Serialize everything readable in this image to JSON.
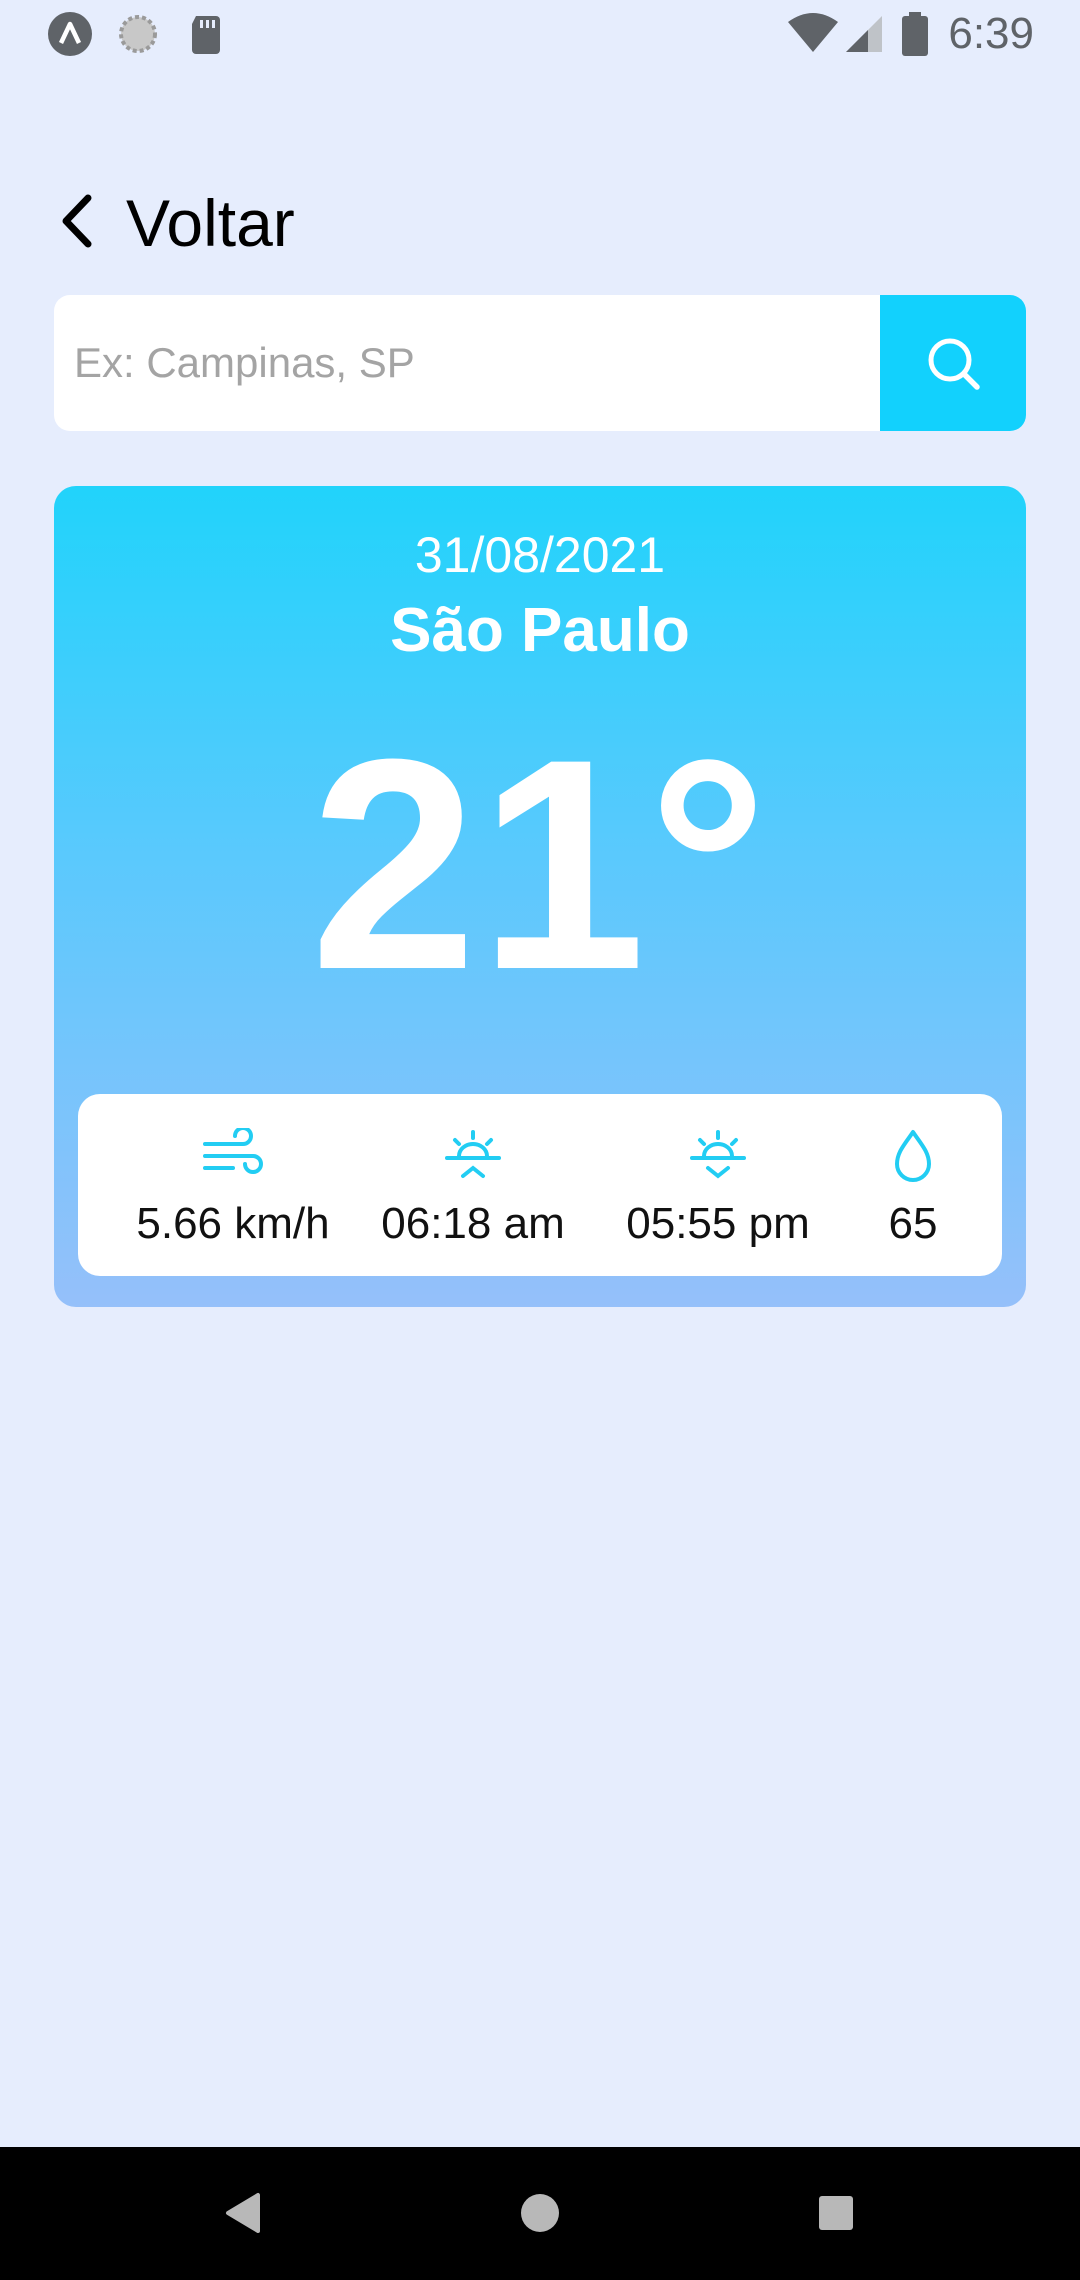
{
  "status_bar": {
    "time": "6:39",
    "left_icons": [
      "app-notification-icon",
      "sync-icon",
      "sd-card-icon"
    ],
    "right_icons": [
      "wifi-icon",
      "cell-signal-icon",
      "battery-icon"
    ]
  },
  "header": {
    "back_label": "Voltar"
  },
  "search": {
    "placeholder": "Ex: Campinas, SP",
    "value": ""
  },
  "weather": {
    "date": "31/08/2021",
    "city": "São Paulo",
    "temperature": "21°",
    "details": [
      {
        "icon": "wind-icon",
        "value": "5.66 km/h"
      },
      {
        "icon": "sunrise-icon",
        "value": "06:18 am"
      },
      {
        "icon": "sunset-icon",
        "value": "05:55 pm"
      },
      {
        "icon": "humidity-drop-icon",
        "value": "65"
      }
    ]
  },
  "colors": {
    "background": "#e6edfd",
    "accent": "#12d1fd",
    "card_gradient_top": "#21d3fb",
    "card_gradient_bottom": "#95c0fa",
    "icon_color": "#22cdf3"
  },
  "nav_bar": {
    "buttons": [
      "back-nav-icon",
      "home-nav-icon",
      "recents-nav-icon"
    ]
  }
}
